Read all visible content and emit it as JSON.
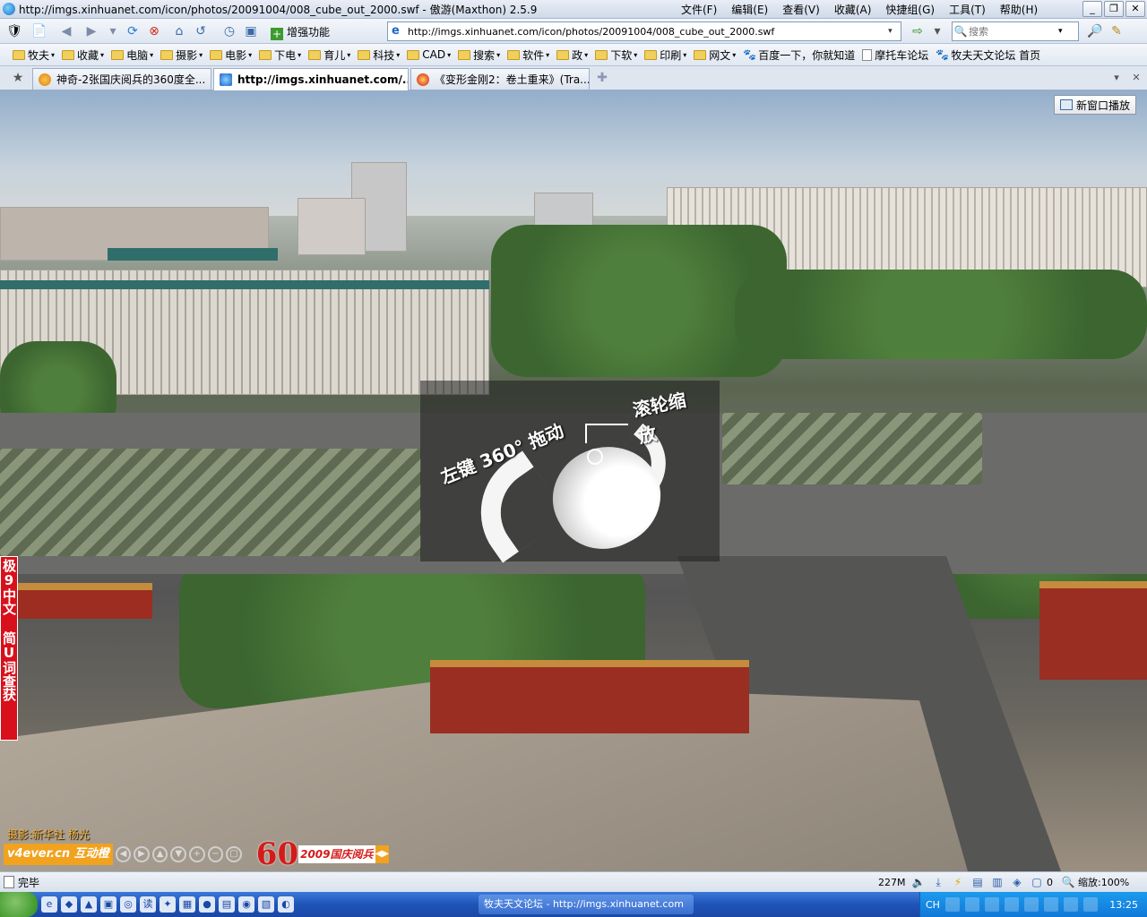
{
  "window": {
    "title": "http://imgs.xinhuanet.com/icon/photos/20091004/008_cube_out_2000.swf - 傲游(Maxthon) 2.5.9",
    "controls": {
      "minimize": "_",
      "restore": "❐",
      "close": "✕"
    }
  },
  "menu": [
    "文件(F)",
    "编辑(E)",
    "查看(V)",
    "收藏(A)",
    "快捷组(G)",
    "工具(T)",
    "帮助(H)"
  ],
  "toolbar": {
    "enhance_label": "增强功能",
    "address_value": "http://imgs.xinhuanet.com/icon/photos/20091004/008_cube_out_2000.swf",
    "search_placeholder": "搜索"
  },
  "bookmarks": [
    {
      "label": "牧夫",
      "type": "folder"
    },
    {
      "label": "收藏",
      "type": "folder"
    },
    {
      "label": "电脑",
      "type": "folder"
    },
    {
      "label": "摄影",
      "type": "folder"
    },
    {
      "label": "电影",
      "type": "folder"
    },
    {
      "label": "下电",
      "type": "folder"
    },
    {
      "label": "育儿",
      "type": "folder"
    },
    {
      "label": "科技",
      "type": "folder"
    },
    {
      "label": "CAD",
      "type": "folder"
    },
    {
      "label": "搜索",
      "type": "folder"
    },
    {
      "label": "软件",
      "type": "folder"
    },
    {
      "label": "政",
      "type": "folder"
    },
    {
      "label": "下软",
      "type": "folder"
    },
    {
      "label": "印刷",
      "type": "folder"
    },
    {
      "label": "网文",
      "type": "folder"
    },
    {
      "label": "百度一下，你就知道",
      "type": "link"
    },
    {
      "label": "摩托车论坛",
      "type": "page"
    },
    {
      "label": "牧夫天文论坛 首页",
      "type": "link"
    }
  ],
  "tabs": [
    {
      "label": "神奇-2张国庆阅兵的360度全...",
      "active": false
    },
    {
      "label": "http://imgs.xinhuanet.com/...",
      "active": true
    },
    {
      "label": "《变形金刚2：卷土重来》(Tra...",
      "active": false
    }
  ],
  "content": {
    "newwin_label": "新窗口播放",
    "overlay_drag": "左键 360° 拖动",
    "overlay_zoom": "滚轮缩放",
    "side_banner": "极9中文 简U词查获",
    "credit": "摄影:新华社 杨光",
    "player_logo": "v4ever.cn 互动橙",
    "badge_60": "60",
    "badge_text": "2009国庆阅兵"
  },
  "status": {
    "text": "完毕",
    "memory": "227M",
    "count": "0",
    "zoom": "缩放:100%"
  },
  "taskbar": {
    "task_label": "牧夫天文论坛 - http://imgs.xinhuanet.com",
    "ime": "CH",
    "clock": "13:25"
  }
}
